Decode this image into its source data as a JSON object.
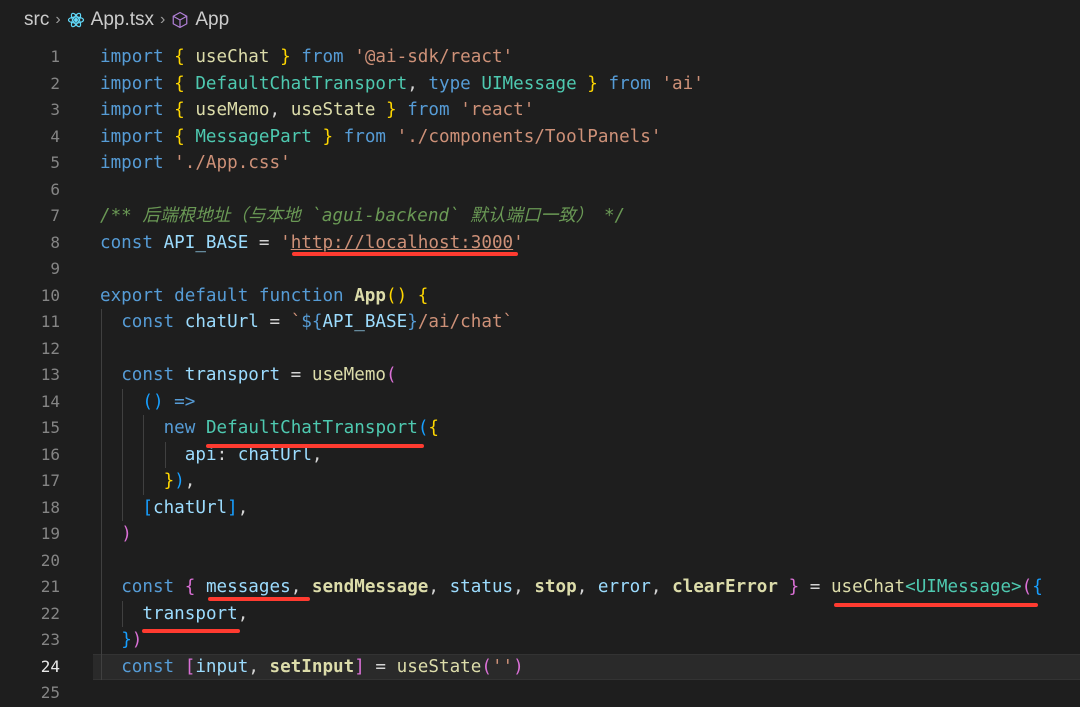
{
  "breadcrumb": {
    "folder": "src",
    "file": "App.tsx",
    "symbol": "App",
    "file_icon": "react-icon",
    "symbol_icon": "cube-icon"
  },
  "editor": {
    "active_line": 24,
    "lines": [
      {
        "n": "1",
        "indent": 0,
        "tokens": [
          [
            "k",
            "import "
          ],
          [
            "b1",
            "{ "
          ],
          [
            "f",
            "useChat"
          ],
          [
            "b1",
            " }"
          ],
          [
            "p",
            " "
          ],
          [
            "k",
            "from"
          ],
          [
            "p",
            " "
          ],
          [
            "s",
            "'@ai-sdk/react'"
          ]
        ]
      },
      {
        "n": "2",
        "indent": 0,
        "tokens": [
          [
            "k",
            "import "
          ],
          [
            "b1",
            "{ "
          ],
          [
            "t",
            "DefaultChatTransport"
          ],
          [
            "p",
            ", "
          ],
          [
            "k",
            "type "
          ],
          [
            "t",
            "UIMessage"
          ],
          [
            "b1",
            " }"
          ],
          [
            "p",
            " "
          ],
          [
            "k",
            "from"
          ],
          [
            "p",
            " "
          ],
          [
            "s",
            "'ai'"
          ]
        ]
      },
      {
        "n": "3",
        "indent": 0,
        "tokens": [
          [
            "k",
            "import "
          ],
          [
            "b1",
            "{ "
          ],
          [
            "f",
            "useMemo"
          ],
          [
            "p",
            ", "
          ],
          [
            "f",
            "useState"
          ],
          [
            "b1",
            " }"
          ],
          [
            "p",
            " "
          ],
          [
            "k",
            "from"
          ],
          [
            "p",
            " "
          ],
          [
            "s",
            "'react'"
          ]
        ]
      },
      {
        "n": "4",
        "indent": 0,
        "tokens": [
          [
            "k",
            "import "
          ],
          [
            "b1",
            "{ "
          ],
          [
            "t",
            "MessagePart"
          ],
          [
            "b1",
            " }"
          ],
          [
            "p",
            " "
          ],
          [
            "k",
            "from"
          ],
          [
            "p",
            " "
          ],
          [
            "s",
            "'./components/ToolPanels'"
          ]
        ]
      },
      {
        "n": "5",
        "indent": 0,
        "tokens": [
          [
            "k",
            "import "
          ],
          [
            "s",
            "'./App.css'"
          ]
        ]
      },
      {
        "n": "6",
        "indent": 0,
        "tokens": []
      },
      {
        "n": "7",
        "indent": 0,
        "tokens": [
          [
            "c",
            "/** 后端根地址（与本地 `agui-backend` 默认端口一致） */"
          ]
        ]
      },
      {
        "n": "8",
        "indent": 0,
        "tokens": [
          [
            "k",
            "const "
          ],
          [
            "v",
            "API_BASE"
          ],
          [
            "p",
            " = "
          ],
          [
            "s",
            "'"
          ],
          [
            "su",
            "http://localhost:3000"
          ],
          [
            "s",
            "'"
          ]
        ]
      },
      {
        "n": "9",
        "indent": 0,
        "tokens": []
      },
      {
        "n": "10",
        "indent": 0,
        "tokens": [
          [
            "k",
            "export default function "
          ],
          [
            "fb",
            "App"
          ],
          [
            "b1",
            "()"
          ],
          [
            "p",
            " "
          ],
          [
            "b1",
            "{"
          ]
        ]
      },
      {
        "n": "11",
        "indent": 1,
        "tokens": [
          [
            "k",
            "const "
          ],
          [
            "v",
            "chatUrl"
          ],
          [
            "p",
            " = "
          ],
          [
            "s",
            "`"
          ],
          [
            "k",
            "${"
          ],
          [
            "v",
            "API_BASE"
          ],
          [
            "k",
            "}"
          ],
          [
            "s",
            "/ai/chat`"
          ]
        ]
      },
      {
        "n": "12",
        "indent": 1,
        "tokens": []
      },
      {
        "n": "13",
        "indent": 1,
        "tokens": [
          [
            "k",
            "const "
          ],
          [
            "v",
            "transport"
          ],
          [
            "p",
            " = "
          ],
          [
            "f",
            "useMemo"
          ],
          [
            "b2",
            "("
          ]
        ]
      },
      {
        "n": "14",
        "indent": 2,
        "tokens": [
          [
            "b3",
            "()"
          ],
          [
            "p",
            " "
          ],
          [
            "k",
            "=>"
          ]
        ]
      },
      {
        "n": "15",
        "indent": 3,
        "tokens": [
          [
            "k",
            "new "
          ],
          [
            "t",
            "DefaultChatTransport"
          ],
          [
            "b3",
            "("
          ],
          [
            "b1",
            "{"
          ]
        ]
      },
      {
        "n": "16",
        "indent": 4,
        "tokens": [
          [
            "v",
            "api"
          ],
          [
            "p",
            ": "
          ],
          [
            "v",
            "chatUrl"
          ],
          [
            "p",
            ","
          ]
        ]
      },
      {
        "n": "17",
        "indent": 3,
        "tokens": [
          [
            "b1",
            "}"
          ],
          [
            "b3",
            ")"
          ],
          [
            "p",
            ","
          ]
        ]
      },
      {
        "n": "18",
        "indent": 2,
        "tokens": [
          [
            "b3",
            "["
          ],
          [
            "v",
            "chatUrl"
          ],
          [
            "b3",
            "]"
          ],
          [
            "p",
            ","
          ]
        ]
      },
      {
        "n": "19",
        "indent": 1,
        "tokens": [
          [
            "b2",
            ")"
          ]
        ]
      },
      {
        "n": "20",
        "indent": 1,
        "tokens": []
      },
      {
        "n": "21",
        "indent": 1,
        "tokens": [
          [
            "k",
            "const "
          ],
          [
            "b2",
            "{ "
          ],
          [
            "v",
            "messages"
          ],
          [
            "p",
            ", "
          ],
          [
            "fb",
            "sendMessage"
          ],
          [
            "p",
            ", "
          ],
          [
            "v",
            "status"
          ],
          [
            "p",
            ", "
          ],
          [
            "fb",
            "stop"
          ],
          [
            "p",
            ", "
          ],
          [
            "v",
            "error"
          ],
          [
            "p",
            ", "
          ],
          [
            "fb",
            "clearError"
          ],
          [
            "b2",
            " }"
          ],
          [
            "p",
            " = "
          ],
          [
            "f",
            "useChat"
          ],
          [
            "t",
            "<UIMessage>"
          ],
          [
            "b2",
            "("
          ],
          [
            "b3",
            "{"
          ]
        ]
      },
      {
        "n": "22",
        "indent": 2,
        "tokens": [
          [
            "v",
            "transport"
          ],
          [
            "p",
            ","
          ]
        ]
      },
      {
        "n": "23",
        "indent": 1,
        "tokens": [
          [
            "b3",
            "}"
          ],
          [
            "b2",
            ")"
          ]
        ]
      },
      {
        "n": "24",
        "indent": 1,
        "tokens": [
          [
            "k",
            "const "
          ],
          [
            "b2",
            "["
          ],
          [
            "v",
            "input"
          ],
          [
            "p",
            ", "
          ],
          [
            "fb",
            "setInput"
          ],
          [
            "b2",
            "]"
          ],
          [
            "p",
            " = "
          ],
          [
            "f",
            "useState"
          ],
          [
            "b2",
            "("
          ],
          [
            "s",
            "''"
          ],
          [
            "b2",
            ")"
          ]
        ]
      },
      {
        "n": "25",
        "indent": 0,
        "tokens": []
      }
    ]
  },
  "colors": {
    "annotation": "#ff3b30",
    "background": "#1e1e1e"
  }
}
